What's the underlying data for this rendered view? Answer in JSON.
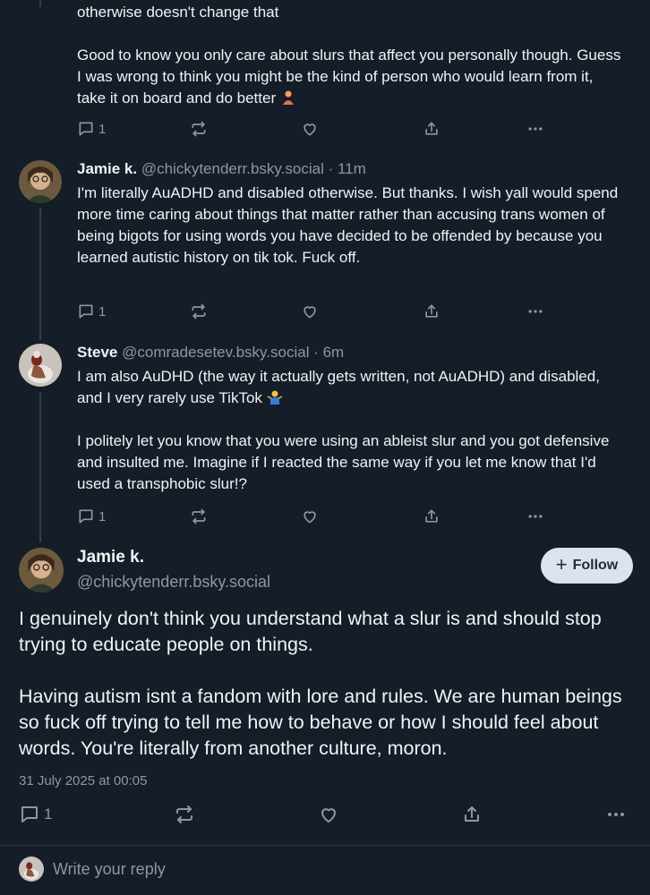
{
  "posts": [
    {
      "partial_line": "otherwise doesn't change that",
      "paragraph": "Good to know you only care about slurs that affect you personally though. Guess I was wrong to think you might be the kind of person who would learn from it, take it on board and do better",
      "emoji": "person-gesturing-icon",
      "reply_count": "1"
    },
    {
      "name": "Jamie k.",
      "handle": "@chickytenderr.bsky.social",
      "time": "· 11m",
      "text": "I'm literally AuADHD and disabled otherwise. But thanks. I wish yall would spend more time caring about things that matter rather than accusing trans women of being bigots for using words you have decided to be offended by because you learned autistic history on tik tok. Fuck off.",
      "reply_count": "1"
    },
    {
      "name": "Steve",
      "handle": "@comradesetev.bsky.social",
      "time": "· 6m",
      "text1": "I am also AuDHD (the way it actually gets written, not AuADHD) and disabled, and I very rarely use TikTok",
      "emoji": "person-shrugging-icon",
      "text2": "I politely let you know that you were using an ableist slur and you got defensive and insulted me. Imagine if I reacted the same way if you let me know that I'd used a transphobic slur!?",
      "reply_count": "1"
    }
  ],
  "main_post": {
    "name": "Jamie k.",
    "handle": "@chickytenderr.bsky.social",
    "follow_label": "Follow",
    "text1": "I genuinely don't think you understand what a slur is and should stop trying to educate people on things.",
    "text2": "Having autism isnt a fandom with lore and rules. We are human beings so fuck off trying to tell me how to behave or how I should feel about words. You're literally from another culture, moron.",
    "date": "31 July 2025 at 00:05",
    "reply_count": "1"
  },
  "reply_bar": {
    "placeholder": "Write your reply"
  },
  "colors": {
    "background": "#151d28",
    "muted": "#8b98a5",
    "follow_bg": "#dbe3ec",
    "thread_line": "#2e4052"
  }
}
